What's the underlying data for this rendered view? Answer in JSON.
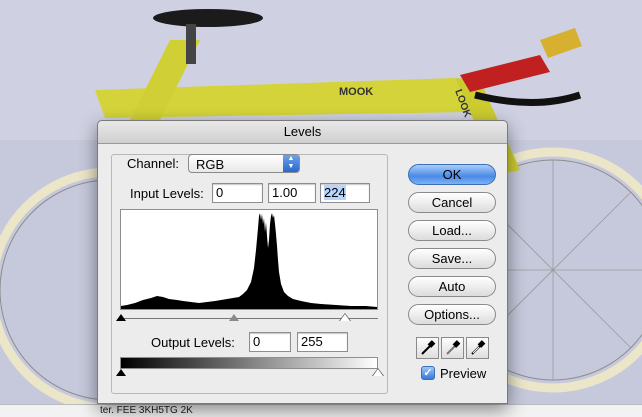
{
  "background": {
    "frame_text": "MOOK",
    "fork_text": "LOOK",
    "bottom_strip_text": "ter. FEE 3KH5TG 2K"
  },
  "dialog": {
    "title": "Levels",
    "channel": {
      "label": "Channel:",
      "value": "RGB"
    },
    "input_levels": {
      "label": "Input Levels:",
      "black": "0",
      "gamma": "1.00",
      "white": "224"
    },
    "output_levels": {
      "label": "Output Levels:",
      "black": "0",
      "white": "255"
    },
    "buttons": {
      "ok": "OK",
      "cancel": "Cancel",
      "load": "Load...",
      "save": "Save...",
      "auto": "Auto",
      "options": "Options..."
    },
    "eyedroppers": [
      "black-point-eyedropper-icon",
      "gray-point-eyedropper-icon",
      "white-point-eyedropper-icon"
    ],
    "preview": {
      "label": "Preview",
      "checked": true
    },
    "colors": {
      "accent": "#4a8ae6",
      "dialog_bg": "#ececec"
    }
  }
}
